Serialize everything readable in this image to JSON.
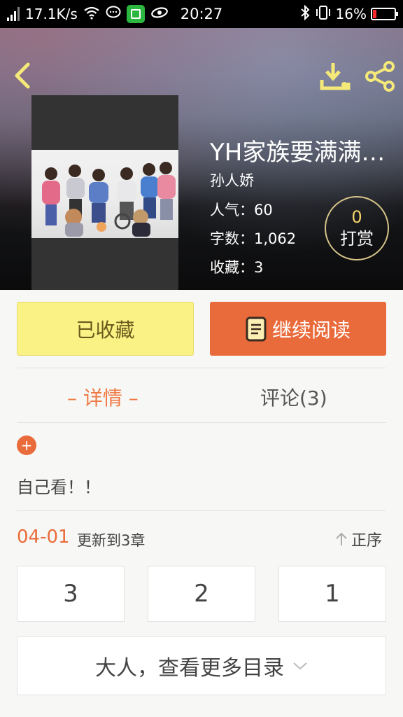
{
  "status_bar": {
    "net_speed": "17.1K/s",
    "time": "20:27",
    "battery": "16%",
    "battery_level": 0.16,
    "icons": [
      "signal-icon",
      "wifi-icon",
      "chat-bubble-icon",
      "wechat-app-icon",
      "eye-icon",
      "bluetooth-icon",
      "vibrate-icon",
      "battery-icon"
    ]
  },
  "header": {
    "title": "YH家族要满满…",
    "author": "孙人娇",
    "popularity": "人气：60",
    "word_count": "字数：1,062",
    "favorites": "收藏：3",
    "reward_count": "0",
    "reward_label": "打赏",
    "icons": [
      "back-icon",
      "download-icon",
      "share-icon"
    ]
  },
  "actions": {
    "favorited_label": "已收藏",
    "read_label": "继续阅读"
  },
  "tabs": {
    "detail": "– 详情 –",
    "comments": "评论(3)"
  },
  "description": "自己看！！",
  "update": {
    "date": "04-01",
    "text": "更新到3章",
    "sort_label": "正序"
  },
  "chapters": [
    "3",
    "2",
    "1"
  ],
  "more_label": "大人，查看更多目录",
  "colors": {
    "accent_orange": "#e96b3b",
    "favorite_yellow": "#fbf286",
    "icon_yellow": "#f5e97a"
  }
}
